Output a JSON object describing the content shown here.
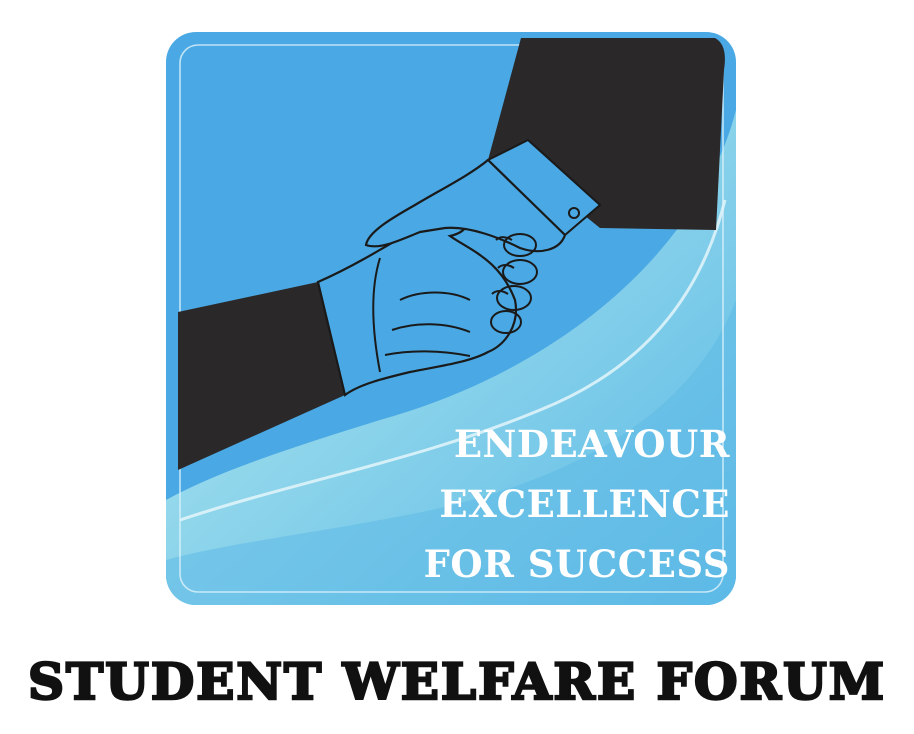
{
  "logo": {
    "motto_lines": [
      "ENDEAVOUR",
      "EXCELLENCE",
      "FOR SUCCESS"
    ],
    "colors": {
      "panel": "#4aa9e4",
      "panel_light": "#a6dde8",
      "sleeve": "#2a2829",
      "outline": "#1a1a1a",
      "text": "#ffffff"
    },
    "icon": "handshake-icon"
  },
  "organization": {
    "name": "STUDENT WELFARE FORUM",
    "text_color": "#111111"
  }
}
